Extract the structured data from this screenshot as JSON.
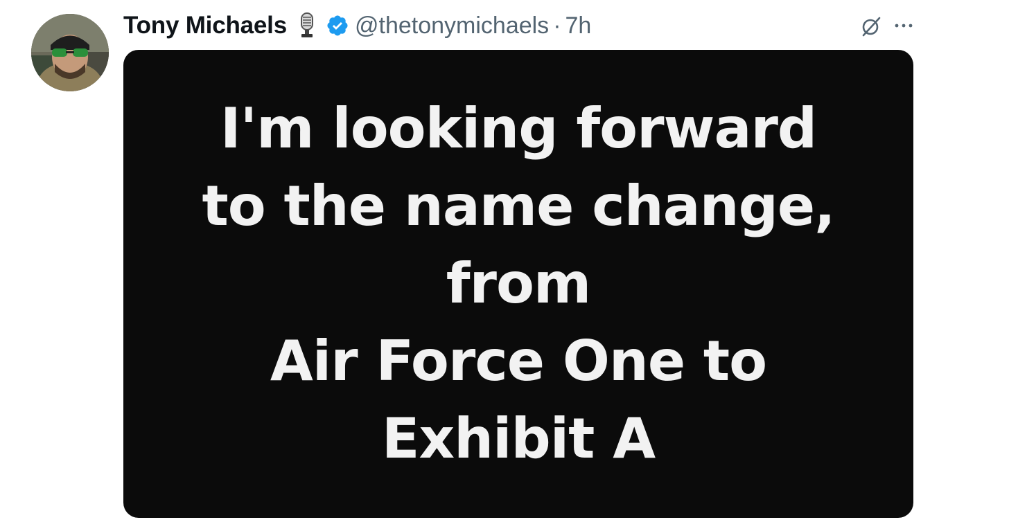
{
  "post": {
    "author": {
      "display_name": "Tony Michaels",
      "handle": "@thetonymichaels",
      "verified": true,
      "name_emoji": "studio-microphone"
    },
    "separator": "·",
    "timestamp": "7h",
    "actions": {
      "grok_icon": "grok-icon",
      "more_icon": "more-options-icon"
    },
    "media": {
      "lines": [
        "I'm looking forward",
        "to the name change,",
        "from",
        "Air Force One to",
        "Exhibit A"
      ]
    }
  },
  "colors": {
    "name": "#0f1419",
    "secondary": "#536471",
    "verified": "#1d9bf0",
    "media_bg": "#0b0b0b",
    "media_text": "#f2f2f2"
  }
}
